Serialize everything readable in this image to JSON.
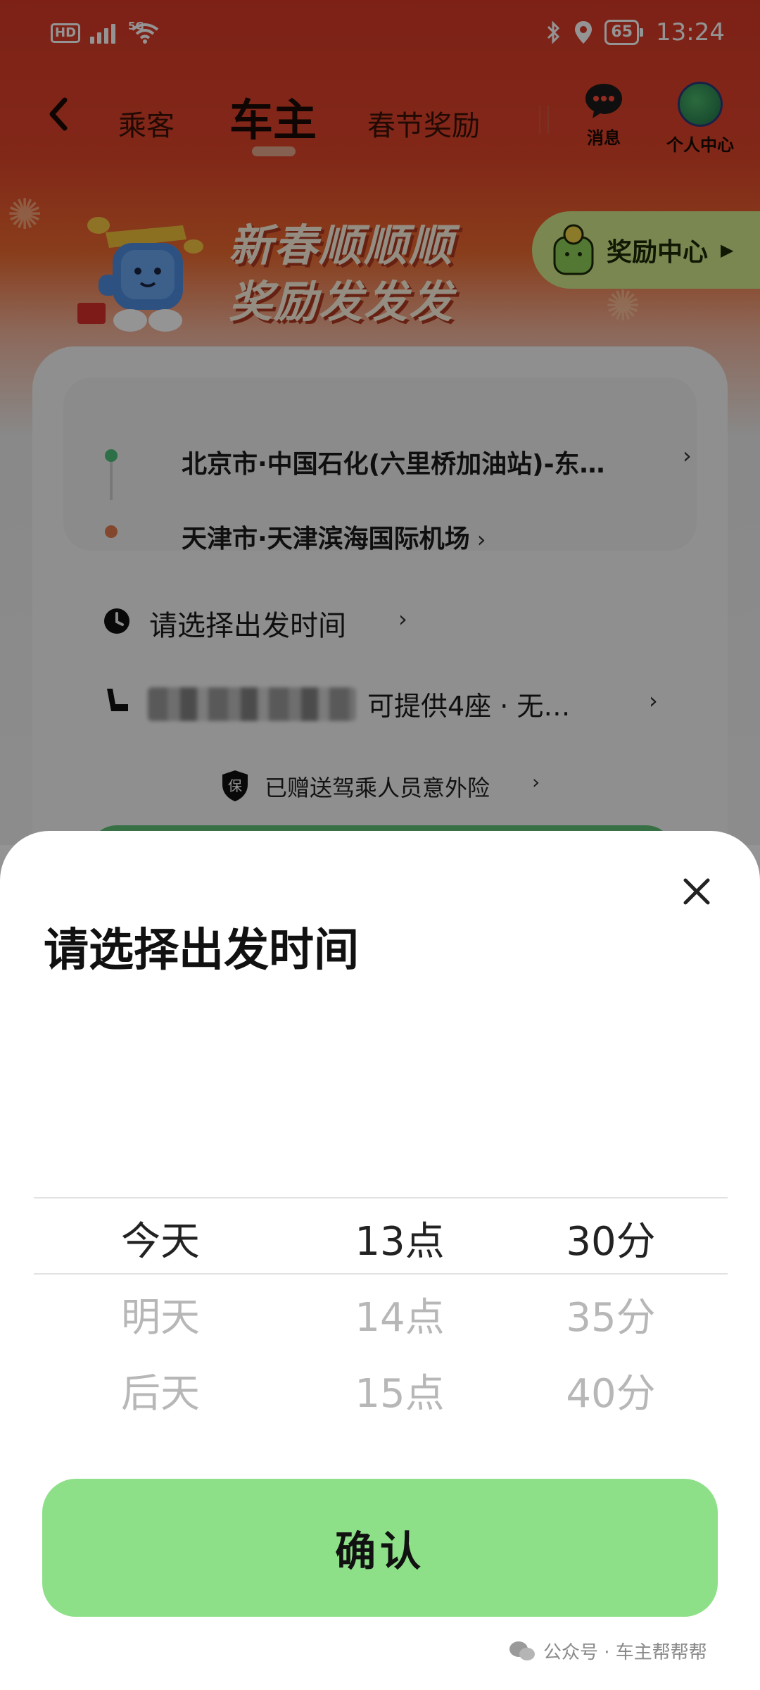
{
  "status_bar": {
    "hd": "HD",
    "network": "5G",
    "battery": "65",
    "time": "13:24"
  },
  "nav": {
    "tabs": [
      {
        "label": "乘客",
        "active": false
      },
      {
        "label": "车主",
        "active": true
      },
      {
        "label": "春节奖励",
        "active": false
      }
    ],
    "messages_label": "消息",
    "profile_label": "个人中心"
  },
  "banner": {
    "line1": "新春顺顺顺",
    "line2": "奖励发发发",
    "reward_center_label": "奖励中心"
  },
  "route": {
    "from": "北京市·中国石化(六里桥加油站)-东…",
    "to": "天津市·天津滨海国际机场"
  },
  "trip": {
    "time_placeholder": "请选择出发时间",
    "seat_text": "可提供4座 · 无…",
    "insurance_text": "已赠送驾乘人员意外险",
    "insurance_icon_text": "保"
  },
  "sheet": {
    "title": "请选择出发时间",
    "days": [
      "今天",
      "明天",
      "后天"
    ],
    "hours": [
      "13点",
      "14点",
      "15点"
    ],
    "minutes": [
      "30分",
      "35分",
      "40分"
    ],
    "selected": {
      "day": "今天",
      "hour": "13点",
      "minute": "30分"
    },
    "confirm_label": "确认"
  },
  "watermark": "公众号 · 车主帮帮帮",
  "colors": {
    "header_red": "#d83a28",
    "confirm_green": "#8ee088",
    "reward_green": "#d2e98c"
  }
}
